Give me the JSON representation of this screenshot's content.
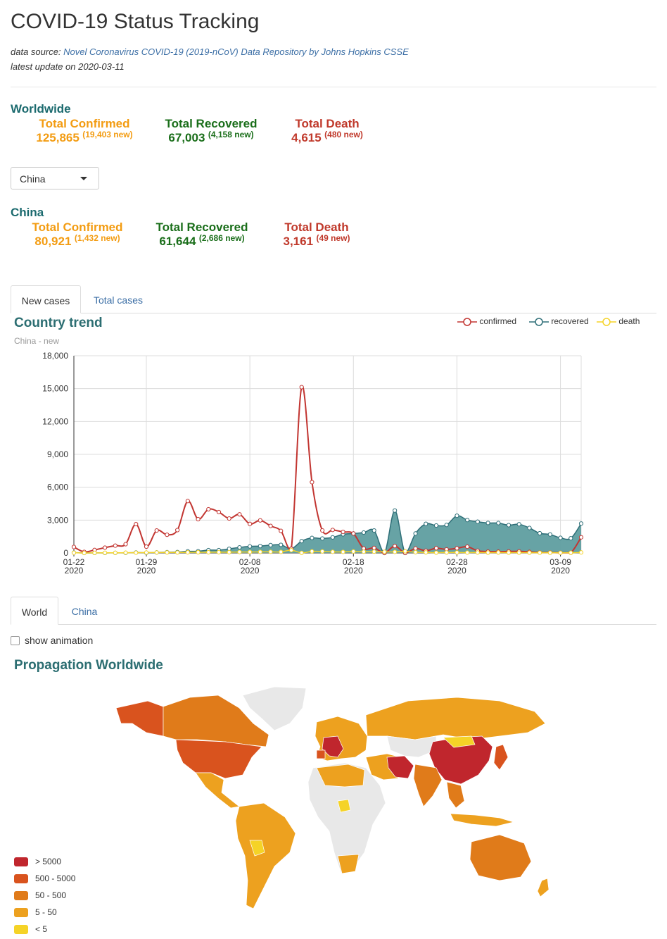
{
  "header": {
    "title": "COVID-19 Status Tracking",
    "source_prefix": "data source:",
    "source_link": "Novel Coronavirus COVID-19 (2019-nCoV) Data Repository by Johns Hopkins CSSE",
    "latest_update": "latest update on 2020-03-11"
  },
  "worldwide": {
    "heading": "Worldwide",
    "confirmed": {
      "label": "Total Confirmed",
      "value": "125,865",
      "new": "(19,403 new)"
    },
    "recovered": {
      "label": "Total Recovered",
      "value": "67,003",
      "new": "(4,158 new)"
    },
    "death": {
      "label": "Total Death",
      "value": "4,615",
      "new": "(480 new)"
    }
  },
  "country_select": {
    "selected": "China"
  },
  "country": {
    "heading": "China",
    "confirmed": {
      "label": "Total Confirmed",
      "value": "80,921",
      "new": "(1,432 new)"
    },
    "recovered": {
      "label": "Total Recovered",
      "value": "61,644",
      "new": "(2,686 new)"
    },
    "death": {
      "label": "Total Death",
      "value": "3,161",
      "new": "(49 new)"
    }
  },
  "trend_tabs": [
    "New cases",
    "Total cases"
  ],
  "map_tabs": [
    "World",
    "China"
  ],
  "colors": {
    "confirmed": "#c23531",
    "recovered": "#2f6f78",
    "recovered_fill": "#5f9ea0",
    "death": "#f5d327",
    "accent": "#2c6e72"
  },
  "chart_data": {
    "type": "line",
    "title": "Country trend",
    "subtitle": "China - new",
    "y_ticks": [
      "0",
      "3,000",
      "6,000",
      "9,000",
      "12,000",
      "15,000",
      "18,000"
    ],
    "ylim": [
      0,
      18000
    ],
    "x_tick_labels": [
      {
        "date": "01-22",
        "year": "2020",
        "index": 0
      },
      {
        "date": "01-29",
        "year": "2020",
        "index": 7
      },
      {
        "date": "02-08",
        "year": "2020",
        "index": 17
      },
      {
        "date": "02-18",
        "year": "2020",
        "index": 27
      },
      {
        "date": "02-28",
        "year": "2020",
        "index": 37
      },
      {
        "date": "03-09",
        "year": "2020",
        "index": 47
      }
    ],
    "grid": true,
    "legend_position": "top-right",
    "x": [
      "01-22",
      "01-23",
      "01-24",
      "01-25",
      "01-26",
      "01-27",
      "01-28",
      "01-29",
      "01-30",
      "01-31",
      "02-01",
      "02-02",
      "02-03",
      "02-04",
      "02-05",
      "02-06",
      "02-07",
      "02-08",
      "02-09",
      "02-10",
      "02-11",
      "02-12",
      "02-13",
      "02-14",
      "02-15",
      "02-16",
      "02-17",
      "02-18",
      "02-19",
      "02-20",
      "02-21",
      "02-22",
      "02-23",
      "02-24",
      "02-25",
      "02-26",
      "02-27",
      "02-28",
      "02-29",
      "03-01",
      "03-02",
      "03-03",
      "03-04",
      "03-05",
      "03-06",
      "03-07",
      "03-08",
      "03-09",
      "03-10",
      "03-11"
    ],
    "series": [
      {
        "name": "confirmed",
        "values": [
          548,
          95,
          277,
          486,
          669,
          802,
          2632,
          578,
          2054,
          1661,
          2089,
          4739,
          3086,
          3991,
          3733,
          3147,
          3523,
          2652,
          2973,
          2467,
          2015,
          382,
          15136,
          6463,
          2055,
          2100,
          1921,
          1777,
          408,
          458,
          4,
          630,
          5,
          409,
          205,
          433,
          327,
          427,
          573,
          202,
          125,
          119,
          139,
          143,
          99,
          44,
          40,
          19,
          24,
          1432
        ]
      },
      {
        "name": "recovered",
        "values": [
          28,
          2,
          6,
          3,
          10,
          9,
          43,
          21,
          47,
          72,
          85,
          147,
          157,
          262,
          262,
          378,
          510,
          600,
          632,
          716,
          744,
          392,
          1081,
          1373,
          1323,
          1425,
          1701,
          1779,
          1862,
          2053,
          0,
          3876,
          0,
          1778,
          2660,
          2507,
          2561,
          3399,
          3010,
          2853,
          2738,
          2730,
          2539,
          2624,
          2284,
          1800,
          1690,
          1384,
          1344,
          2686
        ]
      },
      {
        "name": "death",
        "values": [
          17,
          1,
          8,
          16,
          14,
          26,
          26,
          38,
          43,
          46,
          45,
          57,
          64,
          65,
          73,
          73,
          86,
          89,
          97,
          108,
          97,
          254,
          13,
          143,
          142,
          106,
          98,
          136,
          114,
          118,
          109,
          97,
          150,
          71,
          52,
          29,
          44,
          47,
          35,
          42,
          31,
          38,
          31,
          30,
          28,
          27,
          22,
          17,
          22,
          49
        ]
      }
    ]
  },
  "map": {
    "animation_label": "show animation",
    "title": "Propagation Worldwide",
    "legend": [
      {
        "label": "> 5000",
        "color": "#c0262d"
      },
      {
        "label": "500 - 5000",
        "color": "#d9531e"
      },
      {
        "label": "50 - 500",
        "color": "#e07b1a"
      },
      {
        "label": "5 - 50",
        "color": "#eda11f"
      },
      {
        "label": "< 5",
        "color": "#f5d327"
      }
    ]
  }
}
